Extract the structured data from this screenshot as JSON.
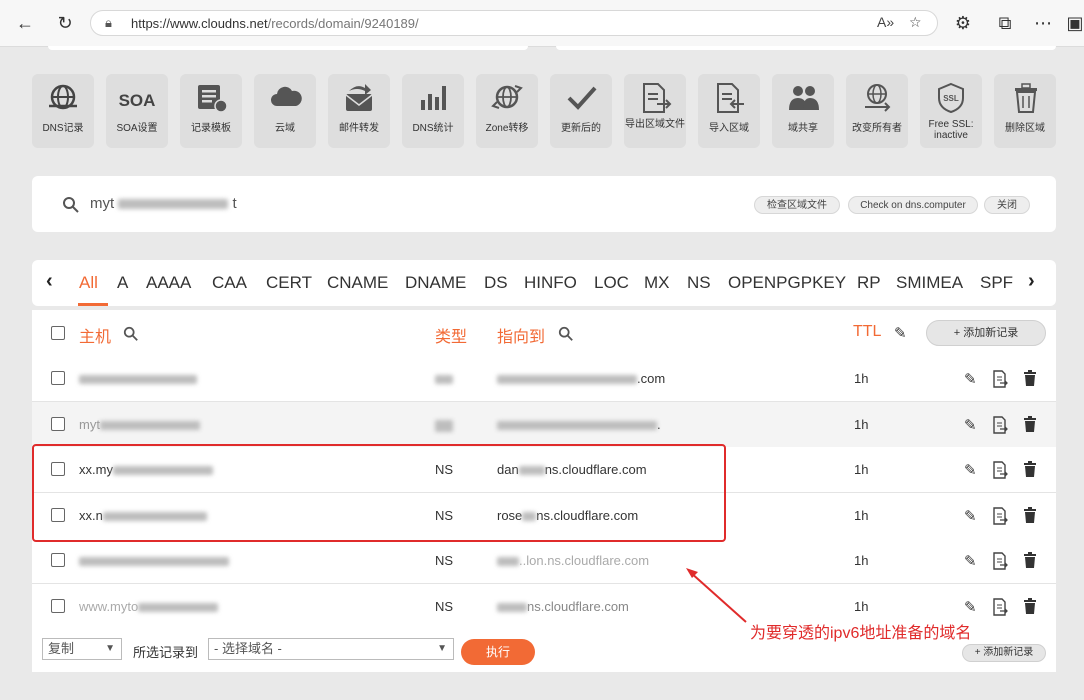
{
  "browser": {
    "url_host": "https://www.cloudns.net",
    "url_path": "/records/domain/9240189/"
  },
  "toolbar": [
    {
      "label": "DNS记录",
      "icon": "globe-icon"
    },
    {
      "label": "SOA",
      "sub": "SOA设置",
      "icon": "soa-icon"
    },
    {
      "label": "记录模板",
      "icon": "template-icon"
    },
    {
      "label": "云域",
      "icon": "cloud-icon"
    },
    {
      "label": "邮件转发",
      "icon": "mail-forward-icon"
    },
    {
      "label": "DNS统计",
      "icon": "bar-chart-icon"
    },
    {
      "label": "Zone转移",
      "icon": "zone-transfer-icon"
    },
    {
      "label": "更新后的",
      "icon": "check-icon"
    },
    {
      "label": "导出区域文件",
      "icon": "export-icon"
    },
    {
      "label": "导入区域",
      "icon": "import-icon"
    },
    {
      "label": "域共享",
      "icon": "users-icon"
    },
    {
      "label": "改变所有者",
      "icon": "change-owner-icon"
    },
    {
      "label": "Free SSL: inactive",
      "icon": "ssl-shield-icon"
    },
    {
      "label": "删除区域",
      "icon": "trash-icon"
    }
  ],
  "search": {
    "zone_visible": "myt",
    "zone_end": "t",
    "check_zone_file": "检查区域文件",
    "check_dns": "Check on dns.computer",
    "close": "关闭"
  },
  "tabs": [
    "All",
    "A",
    "AAAA",
    "CAA",
    "CERT",
    "CNAME",
    "DNAME",
    "DS",
    "HINFO",
    "LOC",
    "MX",
    "NS",
    "OPENPGPKEY",
    "RP",
    "SMIMEA",
    "SPF"
  ],
  "table": {
    "col_host": "主机",
    "col_type": "类型",
    "col_points_to": "指向到",
    "col_ttl": "TTL",
    "add_record": "+ 添加新记录",
    "rows": [
      {
        "host": "",
        "type": "NS",
        "target": ".com",
        "ttl": "1h"
      },
      {
        "host": "myt",
        "type": "",
        "target": ".",
        "ttl": "1h"
      },
      {
        "host": "xx.my",
        "type": "NS",
        "target": "ns.cloudflare.com",
        "target_prefix": "dan",
        "ttl": "1h"
      },
      {
        "host": "xx.n",
        "type": "NS",
        "target": "ns.cloudflare.com",
        "target_prefix": "rose",
        "ttl": "1h"
      },
      {
        "host": "",
        "type": "NS",
        "target": "ns.cloudflare.com",
        "target_prefix": "..lon.",
        "ttl": "1h"
      },
      {
        "host": "www.myto",
        "type": "NS",
        "target": "ns.cloudflare.com",
        "target_prefix": "",
        "ttl": "1h"
      }
    ]
  },
  "footer": {
    "action": "复制",
    "move_label": "所选记录到",
    "domain_placeholder": "- 选择域名 -",
    "execute": "执行",
    "add_record": "+ 添加新记录"
  },
  "annotation": "为要穿透的ipv6地址准备的域名",
  "colors": {
    "accent": "#f26a35",
    "highlight": "#e02b2b"
  }
}
